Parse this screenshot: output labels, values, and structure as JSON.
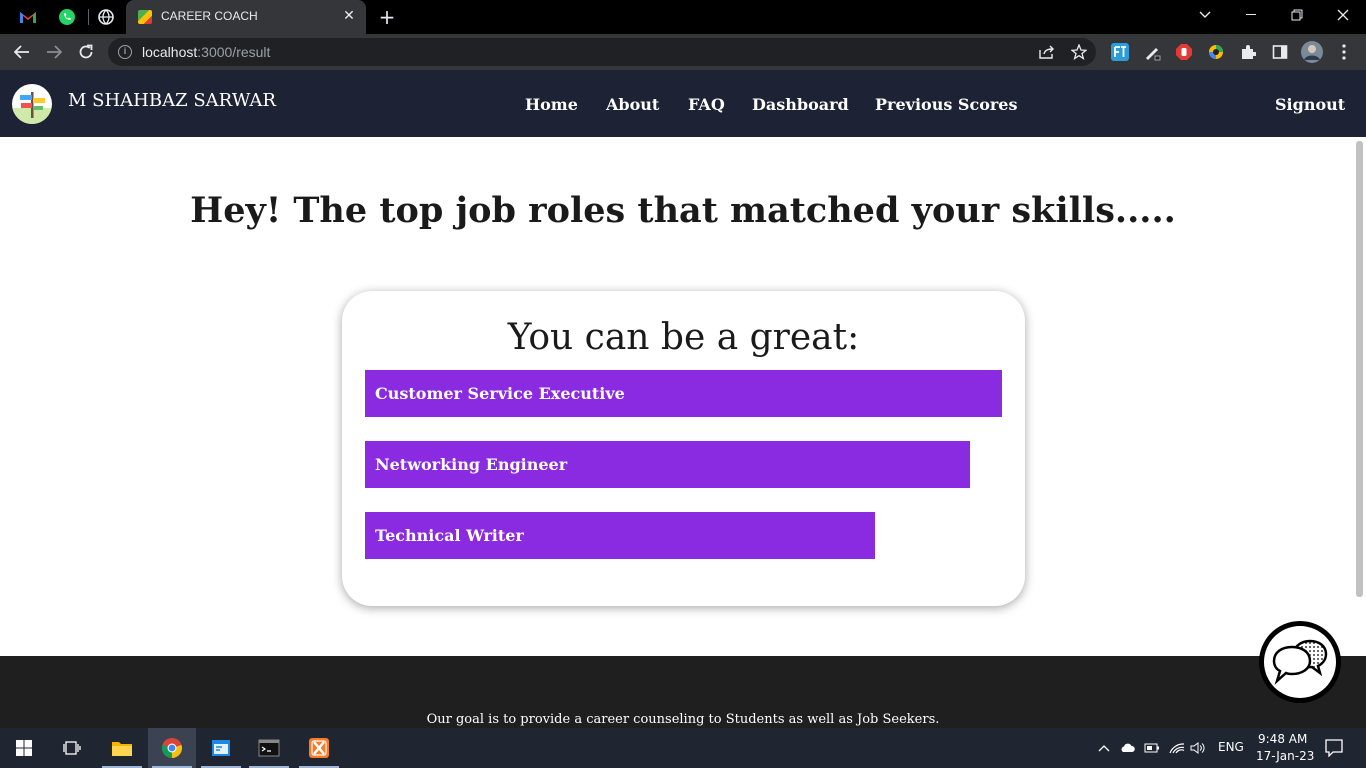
{
  "browser": {
    "tab_title": "CAREER COACH",
    "tab_close": "✕",
    "new_tab": "+",
    "url_host": "localhost",
    "url_path": ":3000/result"
  },
  "nav": {
    "brand": "M SHAHBAZ SARWAR",
    "links": [
      "Home",
      "About",
      "FAQ",
      "Dashboard",
      "Previous Scores"
    ],
    "signout": "Signout"
  },
  "main": {
    "headline": "Hey! The top job roles that matched your skills.....",
    "card_title": "You can be a great:",
    "roles": [
      {
        "label": "Customer Service Executive",
        "match": 1.0
      },
      {
        "label": "Networking Engineer",
        "match": 0.95
      },
      {
        "label": "Technical Writer",
        "match": 0.8
      }
    ]
  },
  "footer": {
    "text": "Our goal is to provide a career counseling to Students as well as Job Seekers."
  },
  "taskbar": {
    "language": "ENG",
    "time": "9:48 AM",
    "date": "17-Jan-23"
  },
  "colors": {
    "nav_bg": "#1d2235",
    "role_bar": "#8a2be2",
    "footer_bg": "#1f1f1f"
  }
}
